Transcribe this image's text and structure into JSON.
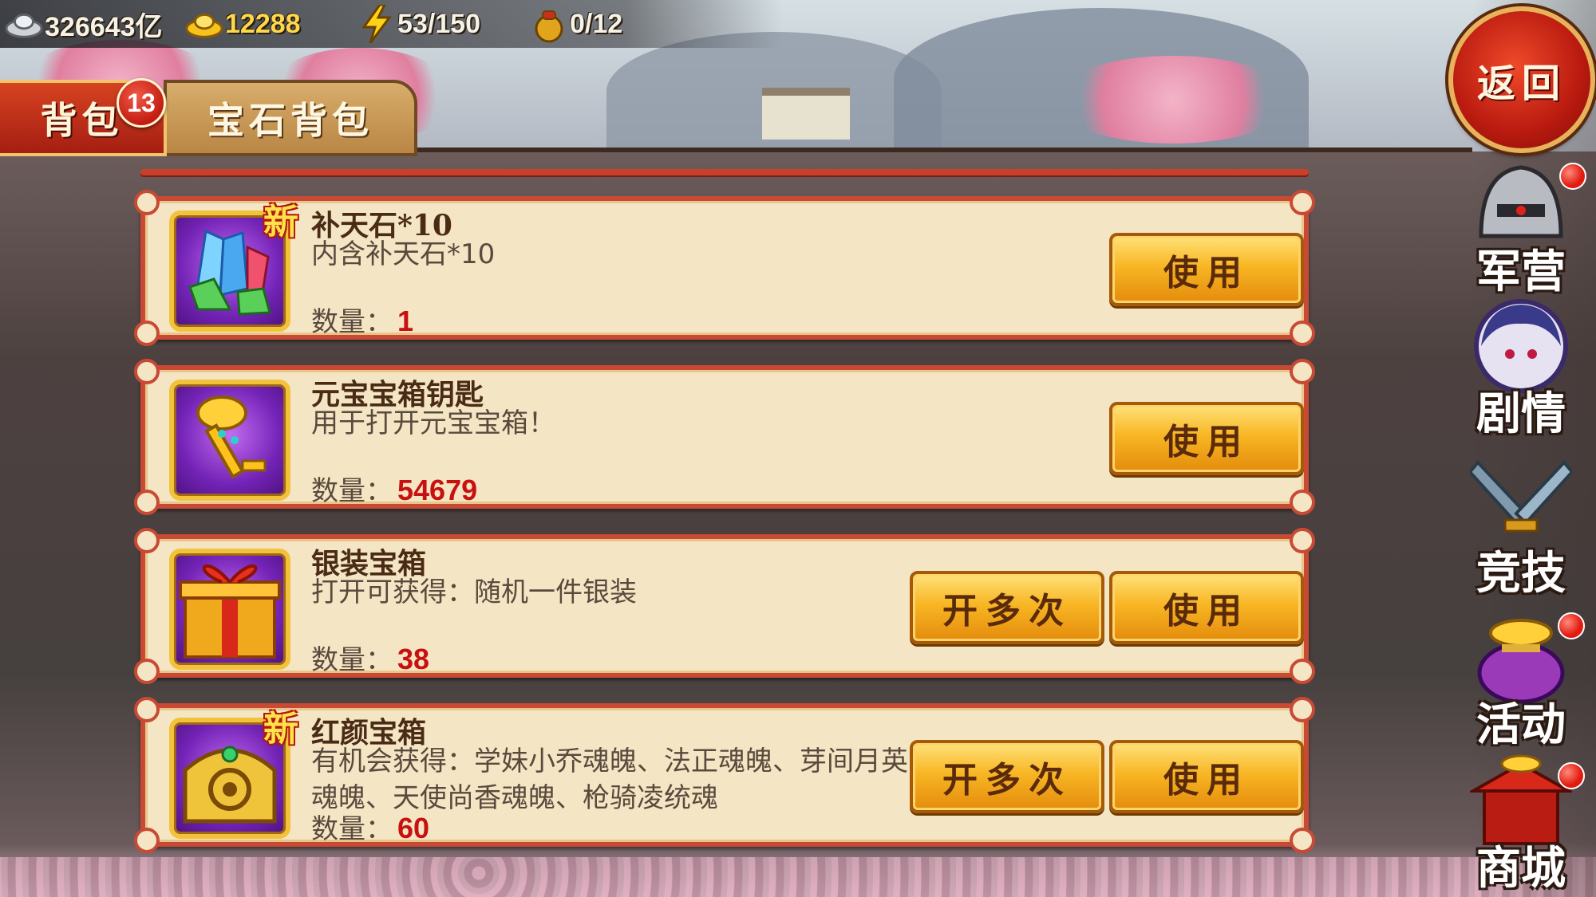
{
  "resources": {
    "silver": "326643亿",
    "gold": "12288",
    "stamina": "53/150",
    "pouch": "0/12"
  },
  "tabs": {
    "backpack": "背包",
    "backpack_badge": "13",
    "gem_backpack": "宝石背包"
  },
  "items": [
    {
      "name": "补天石*10",
      "desc": "内含补天石*10",
      "qty_label": "数量：",
      "qty": "1",
      "is_new": true,
      "new_label": "新",
      "buttons": {
        "use": "使用"
      }
    },
    {
      "name": "元宝宝箱钥匙",
      "desc": "用于打开元宝宝箱！",
      "qty_label": "数量：",
      "qty": "54679",
      "is_new": false,
      "buttons": {
        "use": "使用"
      }
    },
    {
      "name": "银装宝箱",
      "desc": "打开可获得：随机一件银装",
      "qty_label": "数量：",
      "qty": "38",
      "is_new": false,
      "buttons": {
        "multi": "开多次",
        "use": "使用"
      }
    },
    {
      "name": "红颜宝箱",
      "desc": "有机会获得：学妹小乔魂魄、法正魂魄、芽间月英魂魄、天使尚香魂魄、枪骑凌统魂",
      "qty_label": "数量：",
      "qty": "60",
      "is_new": true,
      "new_label": "新",
      "buttons": {
        "multi": "开多次",
        "use": "使用"
      }
    }
  ],
  "nav": {
    "back": "返回",
    "barracks": "军营",
    "story": "剧情",
    "arena": "竞技",
    "events": "活动",
    "shop": "商城"
  },
  "colors": {
    "tab_active": "#c42b18",
    "panel_bg": "#f4e6c4",
    "panel_border": "#c94a34",
    "button": "#f8b624",
    "quantity": "#c81010"
  }
}
